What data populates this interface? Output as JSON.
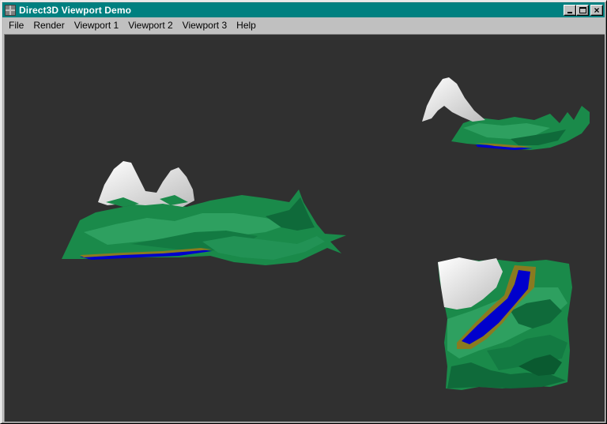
{
  "window": {
    "title": "Direct3D Viewport Demo",
    "icon": "app-icon"
  },
  "title_buttons": {
    "minimize": "minimize-icon",
    "maximize": "maximize-icon",
    "close": "close-icon"
  },
  "menu": {
    "items": [
      "File",
      "Render",
      "Viewport 1",
      "Viewport 2",
      "Viewport 3",
      "Help"
    ]
  },
  "colors": {
    "titlebar": "#008080",
    "viewport_bg": "#303030",
    "terrain_green": "#1a8a4a",
    "snow": "#eeeeee",
    "water": "#0000cc",
    "shore": "#8a7a20"
  }
}
